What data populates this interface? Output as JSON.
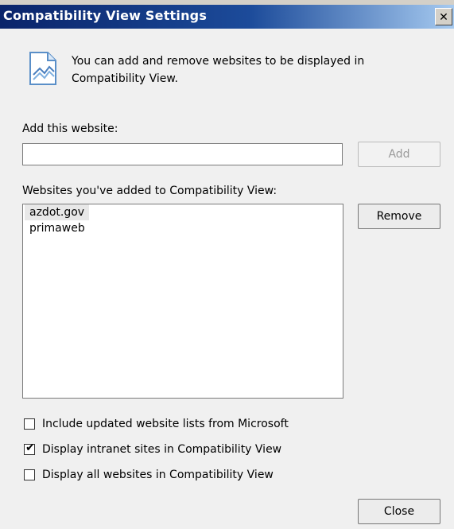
{
  "dialog": {
    "title": "Compatibility View Settings",
    "close_glyph": "✕"
  },
  "intro": {
    "text": "You can add and remove websites to be displayed in Compatibility View.",
    "icon": "webpage-icon"
  },
  "add_section": {
    "label": "Add this website:",
    "input_value": "",
    "add_button_label": "Add"
  },
  "sites_section": {
    "label": "Websites you've added to Compatibility View:",
    "items": [
      "azdot.gov",
      "primaweb"
    ],
    "remove_button_label": "Remove"
  },
  "options": [
    {
      "label": "Include updated website lists from Microsoft",
      "checked": false
    },
    {
      "label": "Display intranet sites in Compatibility View",
      "checked": true
    },
    {
      "label": "Display all websites in Compatibility View",
      "checked": false
    }
  ],
  "footer": {
    "close_button_label": "Close"
  }
}
